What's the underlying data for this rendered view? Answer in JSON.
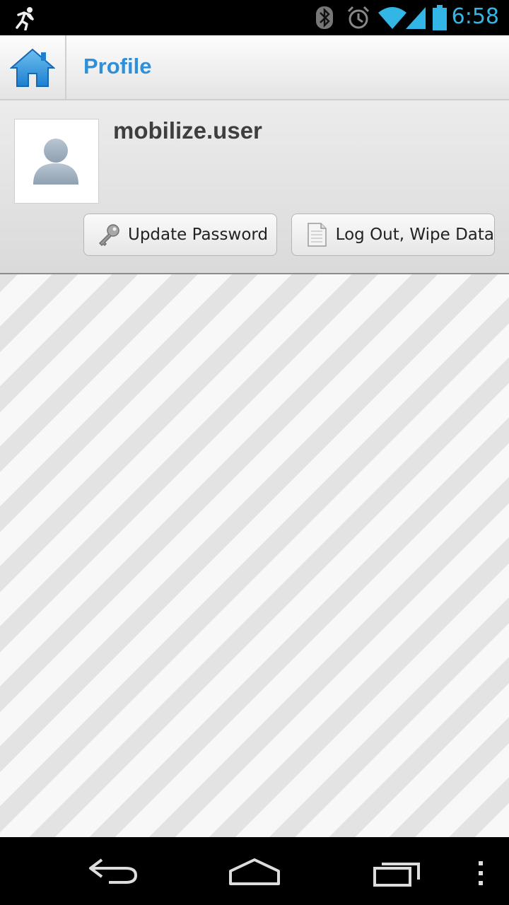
{
  "status_bar": {
    "time": "6:58",
    "icons": [
      "running-icon",
      "bluetooth-icon",
      "alarm-icon",
      "wifi-icon",
      "signal-icon",
      "battery-icon"
    ],
    "accent_color": "#33b5e5"
  },
  "action_bar": {
    "title": "Profile",
    "home_icon": "home-icon",
    "title_color": "#2f8fd8"
  },
  "profile": {
    "username": "mobilize.user",
    "avatar_icon": "person-silhouette-icon",
    "buttons": {
      "update_password": {
        "label": "Update Password",
        "icon": "key-icon"
      },
      "logout": {
        "label": "Log Out, Wipe Data",
        "icon": "document-icon"
      }
    }
  },
  "nav_bar": {
    "icons": [
      "back-icon",
      "home-icon",
      "recent-apps-icon",
      "overflow-menu-icon"
    ]
  }
}
